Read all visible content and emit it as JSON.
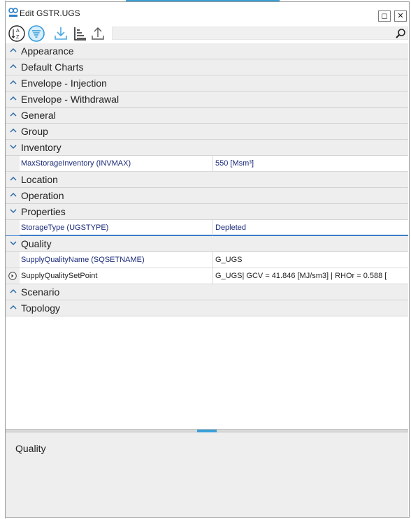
{
  "window": {
    "title": "Edit GSTR.UGS",
    "restore_glyph": "◻",
    "close_glyph": "✕"
  },
  "toolbar": {
    "icons": [
      "sort-alphabetical-icon",
      "categorized-icon",
      "import-icon",
      "sort-order-icon",
      "export-icon"
    ],
    "search_placeholder": ""
  },
  "grid": {
    "appearance": "Appearance",
    "default_charts": "Default Charts",
    "envelope_injection": "Envelope - Injection",
    "envelope_withdrawal": "Envelope - Withdrawal",
    "general": "General",
    "group": "Group",
    "inventory": "Inventory",
    "inventory_prop_name": "MaxStorageInventory (INVMAX)",
    "inventory_prop_value": "550 [Msm³]",
    "location": "Location",
    "operation": "Operation",
    "properties": "Properties",
    "properties_prop_name": "StorageType (UGSTYPE)",
    "properties_prop_value": "Depleted",
    "quality": "Quality",
    "quality_prop1_name": "SupplyQualityName (SQSETNAME)",
    "quality_prop1_value": "G_UGS",
    "quality_prop2_name": "SupplyQualitySetPoint",
    "quality_prop2_value": "G_UGS| GCV =  41.846 [MJ/sm3] | RHOr =  0.588 [",
    "scenario": "Scenario",
    "topology": "Topology"
  },
  "description": {
    "title": "Quality"
  },
  "colors": {
    "accent": "#3aa0d8",
    "selection_line": "#3a7ec8",
    "property_text": "#1a2a7a",
    "category_bg": "#eeeeee"
  }
}
